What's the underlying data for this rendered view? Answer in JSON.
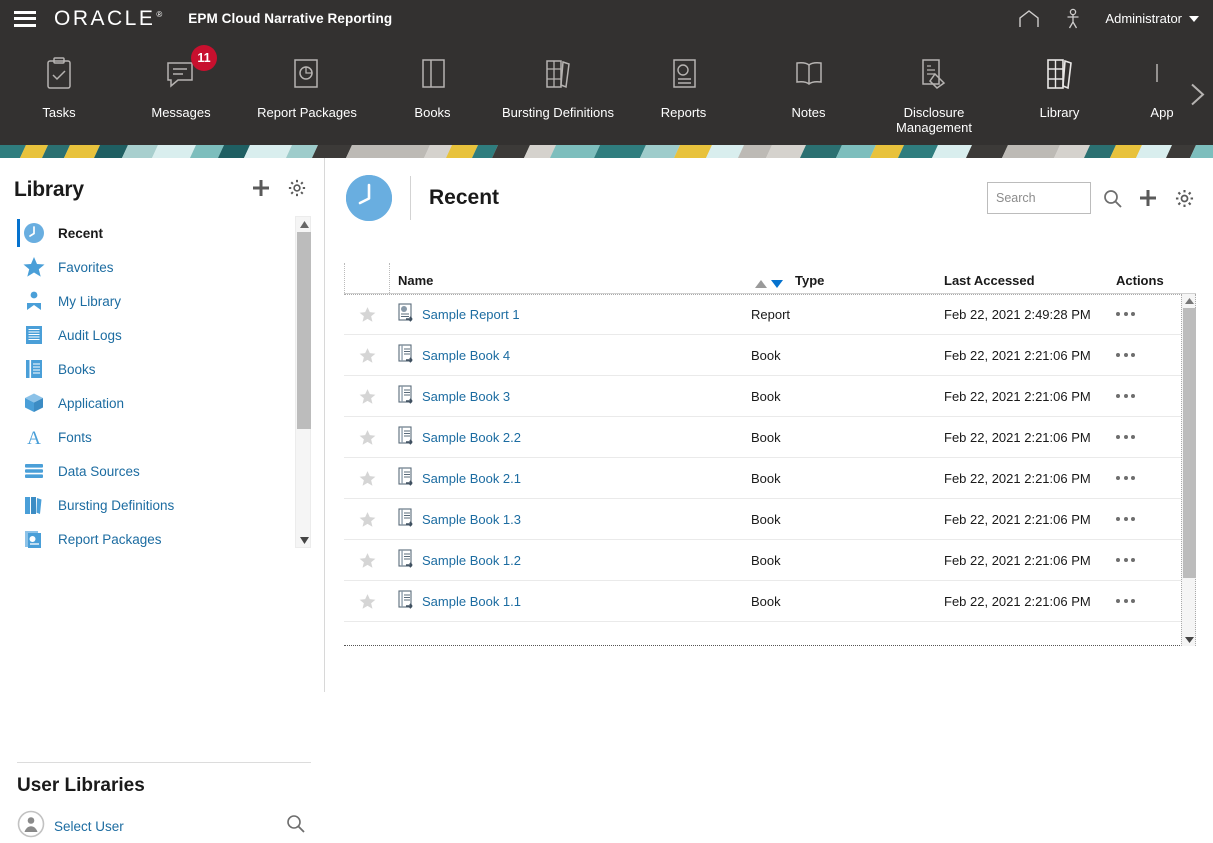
{
  "header": {
    "menu_icon": "hamburger-icon",
    "brand": "ORACLE",
    "brand_tm": "®",
    "app_title": "EPM Cloud Narrative Reporting",
    "home_icon": "home-icon",
    "accessibility_icon": "accessibility-icon",
    "user_label": "Administrator"
  },
  "nav": {
    "items": [
      {
        "label": "Tasks",
        "icon": "clipboard-check-icon",
        "badge": ""
      },
      {
        "label": "Messages",
        "icon": "message-icon",
        "badge": "11"
      },
      {
        "label": "Report Packages",
        "icon": "report-package-icon",
        "badge": ""
      },
      {
        "label": "Books",
        "icon": "book-icon",
        "badge": ""
      },
      {
        "label": "Bursting Definitions",
        "icon": "bursting-books-icon",
        "badge": ""
      },
      {
        "label": "Reports",
        "icon": "report-chart-icon",
        "badge": ""
      },
      {
        "label": "Notes",
        "icon": "open-book-icon",
        "badge": ""
      },
      {
        "label": "Disclosure\nManagement",
        "icon": "disclosure-tag-icon",
        "badge": ""
      },
      {
        "label": "Library",
        "icon": "library-books-icon",
        "badge": ""
      },
      {
        "label": "App",
        "icon": "app-icon",
        "badge": ""
      }
    ],
    "next_icon": "chevron-right-icon"
  },
  "sidebar": {
    "title": "Library",
    "add_icon": "plus-icon",
    "settings_icon": "gear-icon",
    "items": [
      {
        "label": "Recent",
        "icon": "clock-icon",
        "active": true
      },
      {
        "label": "Favorites",
        "icon": "star-icon",
        "active": false
      },
      {
        "label": "My Library",
        "icon": "my-library-icon",
        "active": false
      },
      {
        "label": "Audit Logs",
        "icon": "audit-log-icon",
        "active": false
      },
      {
        "label": "Books",
        "icon": "books-icon",
        "active": false
      },
      {
        "label": "Application",
        "icon": "cube-icon",
        "active": false
      },
      {
        "label": "Fonts",
        "icon": "font-a-icon",
        "active": false
      },
      {
        "label": "Data Sources",
        "icon": "data-source-icon",
        "active": false
      },
      {
        "label": "Bursting Definitions",
        "icon": "bursting-icon",
        "active": false
      },
      {
        "label": "Report Packages",
        "icon": "report-package-icon",
        "active": false
      }
    ],
    "scroll_up_icon": "scroll-up-arrow",
    "scroll_down_icon": "scroll-down-arrow",
    "user_libraries": {
      "title": "User Libraries",
      "select_user_label": "Select User",
      "select_user_icon": "user-avatar-icon",
      "search_icon": "search-icon"
    }
  },
  "main": {
    "title": "Recent",
    "title_icon": "clock-icon",
    "search": {
      "value": "",
      "placeholder": "Search"
    },
    "search_icon": "search-icon",
    "add_icon": "plus-icon",
    "settings_icon": "gear-icon",
    "table": {
      "columns": [
        "",
        "Name",
        "Type",
        "Last Accessed",
        "Actions"
      ],
      "sort": {
        "asc_icon": "sort-ascending-arrow",
        "desc_icon": "sort-descending-arrow",
        "active": "desc"
      },
      "rows": [
        {
          "favorite": false,
          "icon": "report-file-icon",
          "name": "Sample Report 1",
          "type": "Report",
          "last_accessed": "Feb 22, 2021 2:49:28 PM",
          "actions_icon": "more-actions-icon"
        },
        {
          "favorite": false,
          "icon": "book-file-icon",
          "name": "Sample Book 4",
          "type": "Book",
          "last_accessed": "Feb 22, 2021 2:21:06 PM",
          "actions_icon": "more-actions-icon"
        },
        {
          "favorite": false,
          "icon": "book-file-icon",
          "name": "Sample Book 3",
          "type": "Book",
          "last_accessed": "Feb 22, 2021 2:21:06 PM",
          "actions_icon": "more-actions-icon"
        },
        {
          "favorite": false,
          "icon": "book-file-icon",
          "name": "Sample Book 2.2",
          "type": "Book",
          "last_accessed": "Feb 22, 2021 2:21:06 PM",
          "actions_icon": "more-actions-icon"
        },
        {
          "favorite": false,
          "icon": "book-file-icon",
          "name": "Sample Book 2.1",
          "type": "Book",
          "last_accessed": "Feb 22, 2021 2:21:06 PM",
          "actions_icon": "more-actions-icon"
        },
        {
          "favorite": false,
          "icon": "book-file-icon",
          "name": "Sample Book 1.3",
          "type": "Book",
          "last_accessed": "Feb 22, 2021 2:21:06 PM",
          "actions_icon": "more-actions-icon"
        },
        {
          "favorite": false,
          "icon": "book-file-icon",
          "name": "Sample Book 1.2",
          "type": "Book",
          "last_accessed": "Feb 22, 2021 2:21:06 PM",
          "actions_icon": "more-actions-icon"
        },
        {
          "favorite": false,
          "icon": "book-file-icon",
          "name": "Sample Book 1.1",
          "type": "Book",
          "last_accessed": "Feb 22, 2021 2:21:06 PM",
          "actions_icon": "more-actions-icon"
        }
      ]
    }
  },
  "colors": {
    "header_bg": "#333130",
    "badge_red": "#c8102e",
    "link_blue": "#1c6ca1",
    "accent_blue": "#0572ce",
    "icon_blue": "#69aee0"
  }
}
